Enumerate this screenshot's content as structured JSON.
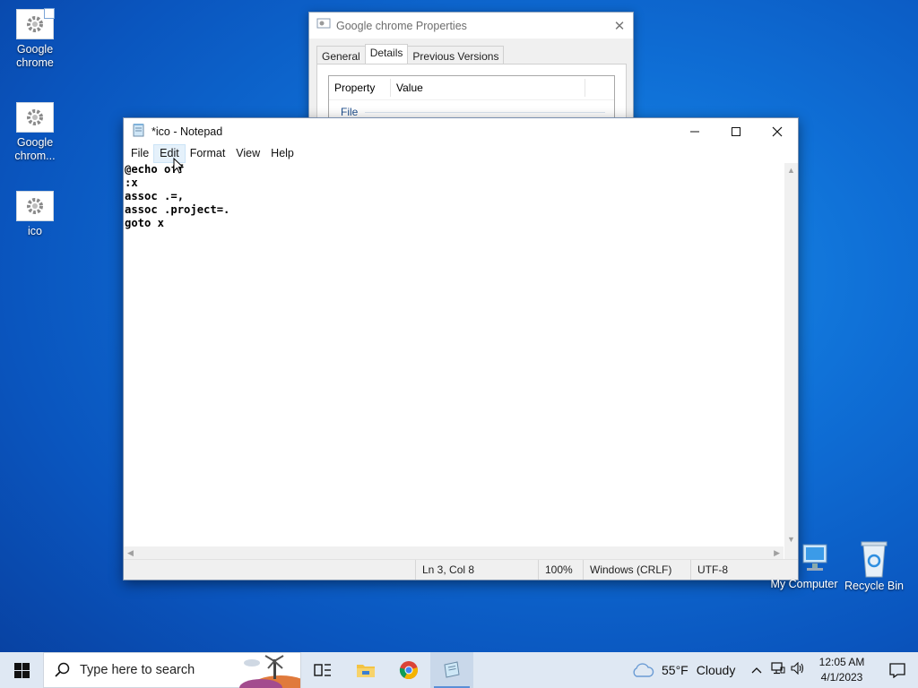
{
  "desktop": {
    "icons": [
      {
        "label": "Google chrome",
        "icon": "gear-shortcut-icon"
      },
      {
        "label": "Google chrom...",
        "icon": "gear-icon"
      },
      {
        "label": "ico",
        "icon": "gear-icon"
      }
    ],
    "right_icons": [
      {
        "label": "My Computer",
        "icon": "computer-icon"
      },
      {
        "label": "Recycle Bin",
        "icon": "recycle-bin-icon"
      }
    ]
  },
  "properties_dialog": {
    "title": "Google chrome Properties",
    "tabs": [
      "General",
      "Details",
      "Previous Versions"
    ],
    "active_tab": "Details",
    "columns": [
      "Property",
      "Value"
    ],
    "group": "File"
  },
  "notepad": {
    "title": "*ico - Notepad",
    "menu": [
      "File",
      "Edit",
      "Format",
      "View",
      "Help"
    ],
    "hover_menu": "Edit",
    "content": "@echo off\n:x\nassoc .=,\nassoc .project=.\ngoto x",
    "status": {
      "position": "Ln 3, Col 8",
      "zoom": "100%",
      "line_ending": "Windows (CRLF)",
      "encoding": "UTF-8"
    }
  },
  "taskbar": {
    "search_placeholder": "Type here to search",
    "weather_temp": "55°F",
    "weather_text": "Cloudy",
    "time": "12:05 AM",
    "date": "4/1/2023",
    "accent": "#0f6fd6"
  }
}
